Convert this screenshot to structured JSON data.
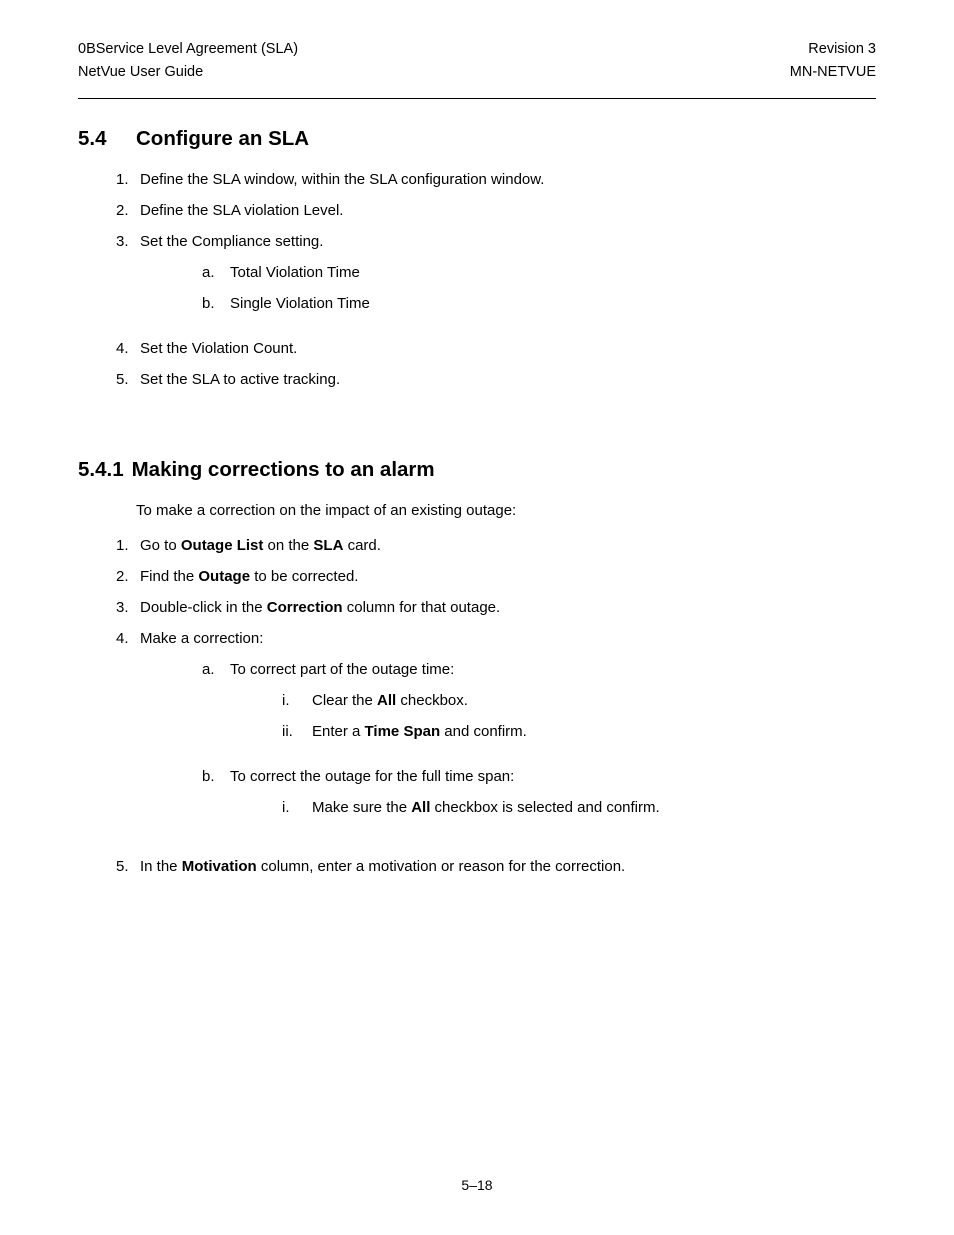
{
  "header": {
    "left_line1": "0BService Level Agreement (SLA)",
    "left_line2": "NetVue User Guide",
    "right_line1": "Revision 3",
    "right_line2": "MN-NETVUE"
  },
  "section54": {
    "number": "5.4",
    "title": "Configure an SLA",
    "items": [
      {
        "marker": "1.",
        "text": "Define the SLA window, within the SLA configuration window."
      },
      {
        "marker": "2.",
        "text": "Define the SLA violation Level."
      },
      {
        "marker": "3.",
        "text": "Set the Compliance setting.",
        "sub": [
          {
            "marker": "a.",
            "text": "Total Violation Time"
          },
          {
            "marker": "b.",
            "text": "Single Violation Time"
          }
        ]
      },
      {
        "marker": "4.",
        "text": "Set the Violation Count."
      },
      {
        "marker": "5.",
        "text": "Set the SLA to active tracking."
      }
    ]
  },
  "section541": {
    "number": "5.4.1",
    "title": "Making corrections to an alarm",
    "intro": "To make a correction on the impact of an existing outage:",
    "items": [
      {
        "marker": "1.",
        "parts": [
          {
            "text": "Go to ",
            "bold": false
          },
          {
            "text": "Outage List",
            "bold": true
          },
          {
            "text": " on the ",
            "bold": false
          },
          {
            "text": "SLA",
            "bold": true
          },
          {
            "text": " card.",
            "bold": false
          }
        ]
      },
      {
        "marker": "2.",
        "parts": [
          {
            "text": "Find the ",
            "bold": false
          },
          {
            "text": "Outage",
            "bold": true
          },
          {
            "text": " to be corrected.",
            "bold": false
          }
        ]
      },
      {
        "marker": "3.",
        "parts": [
          {
            "text": "Double-click in the ",
            "bold": false
          },
          {
            "text": "Correction",
            "bold": true
          },
          {
            "text": " column for that outage.",
            "bold": false
          }
        ]
      },
      {
        "marker": "4.",
        "parts": [
          {
            "text": "Make a correction:",
            "bold": false
          }
        ],
        "sub": [
          {
            "marker": "a.",
            "text": "To correct part of the outage time:",
            "sub": [
              {
                "marker": "i.",
                "parts": [
                  {
                    "text": "Clear the ",
                    "bold": false
                  },
                  {
                    "text": "All",
                    "bold": true
                  },
                  {
                    "text": " checkbox.",
                    "bold": false
                  }
                ]
              },
              {
                "marker": "ii.",
                "parts": [
                  {
                    "text": "Enter a ",
                    "bold": false
                  },
                  {
                    "text": "Time Span",
                    "bold": true
                  },
                  {
                    "text": " and confirm.",
                    "bold": false
                  }
                ]
              }
            ]
          },
          {
            "marker": "b.",
            "text": "To correct the outage for the full time span:",
            "sub": [
              {
                "marker": "i.",
                "parts": [
                  {
                    "text": "Make sure the ",
                    "bold": false
                  },
                  {
                    "text": "All",
                    "bold": true
                  },
                  {
                    "text": " checkbox is selected and confirm.",
                    "bold": false
                  }
                ]
              }
            ]
          }
        ]
      },
      {
        "marker": "5.",
        "parts": [
          {
            "text": "In the ",
            "bold": false
          },
          {
            "text": "Motivation",
            "bold": true
          },
          {
            "text": " column, enter a motivation or reason for the correction.",
            "bold": false
          }
        ]
      }
    ]
  },
  "page_number": "5–18"
}
